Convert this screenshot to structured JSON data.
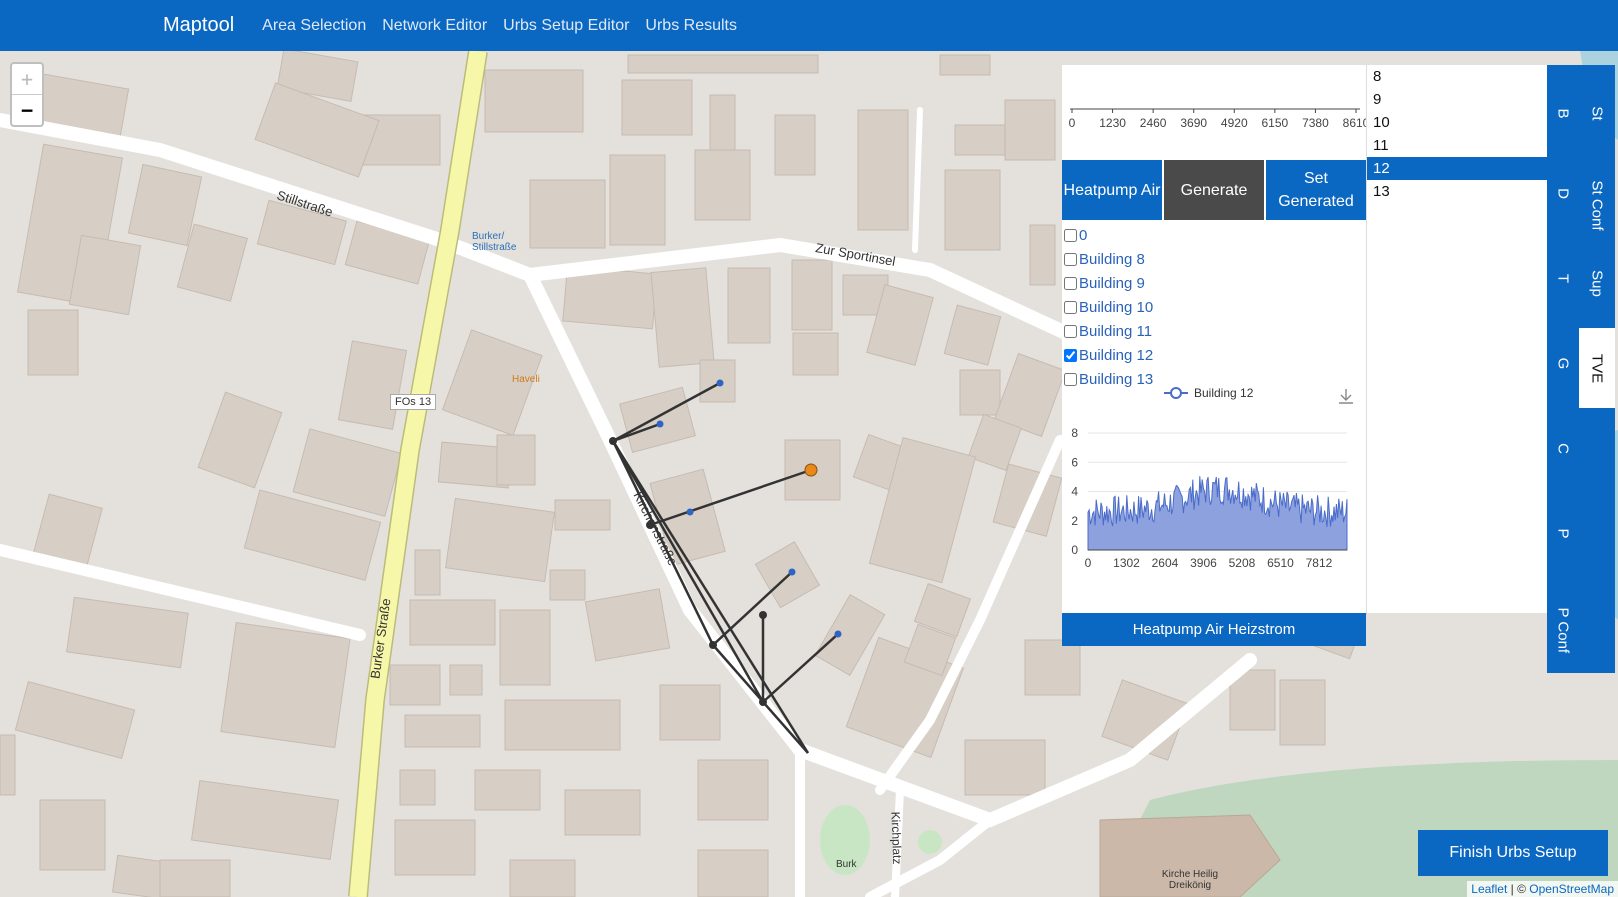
{
  "navbar": {
    "brand": "Maptool",
    "links": [
      "Area Selection",
      "Network Editor",
      "Urbs Setup Editor",
      "Urbs Results"
    ]
  },
  "zoom": {
    "in": "+",
    "out": "−"
  },
  "panel": {
    "top_axis_ticks": [
      "0",
      "1230",
      "2460",
      "3690",
      "4920",
      "6150",
      "7380",
      "8610"
    ],
    "buttons": {
      "heatpump": "Heatpump Air",
      "generate": "Generate",
      "set_generated": "Set Generated"
    },
    "checkboxes": [
      {
        "label": "0",
        "checked": false
      },
      {
        "label": "Building 8",
        "checked": false
      },
      {
        "label": "Building 9",
        "checked": false
      },
      {
        "label": "Building 10",
        "checked": false
      },
      {
        "label": "Building 11",
        "checked": false
      },
      {
        "label": "Building 12",
        "checked": true
      },
      {
        "label": "Building 13",
        "checked": false
      }
    ],
    "bottom_button": "Heatpump Air Heizstrom",
    "list": [
      "8",
      "9",
      "10",
      "11",
      "12",
      "13"
    ],
    "selected_item": "12"
  },
  "chart_data": {
    "type": "area",
    "series": [
      {
        "name": "Building 12",
        "color": "#4a6cc9"
      }
    ],
    "x_ticks": [
      "0",
      "1302",
      "2604",
      "3906",
      "5208",
      "6510",
      "7812"
    ],
    "y_ticks": [
      "0",
      "2",
      "4",
      "6",
      "8"
    ],
    "xlim": [
      0,
      8760
    ],
    "ylim": [
      0,
      8
    ],
    "legend_position": "top"
  },
  "vtabs_inner": [
    "B",
    "D",
    "T",
    "G",
    "C",
    "P",
    "P Conf"
  ],
  "vtabs_outer": [
    "St",
    "St Conf",
    "Sup",
    "TVE"
  ],
  "active_tab": "TVE",
  "finish_button": "Finish Urbs Setup",
  "attribution": {
    "leaflet": "Leaflet",
    "sep": " | © ",
    "osm": "OpenStreetMap"
  },
  "map_labels": {
    "stillstrasse": "Stillstraße",
    "zur_sportinsel": "Zur Sportinsel",
    "burker_strasse": "Burker Straße",
    "kirchenstrasse": "Kirchenstraße",
    "kirchplatz": "Kirchplatz",
    "bus_stop": "Burker/ Stillstraße",
    "restaurant": "Haveli",
    "fos13": "FOs 13",
    "church": "Kirche Heilig Dreikönig",
    "burk": "Burk"
  }
}
